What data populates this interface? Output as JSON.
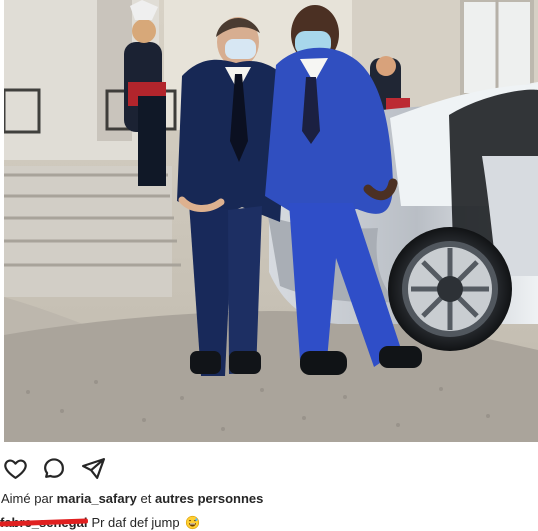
{
  "post": {
    "photo": {
      "description_icon": "photo"
    },
    "actions": [
      {
        "name": "like",
        "icon": "heart-icon"
      },
      {
        "name": "comment",
        "icon": "comment-icon"
      },
      {
        "name": "share",
        "icon": "send-icon"
      }
    ],
    "likes": {
      "prefix": "Aimé par",
      "user": "maria_safary",
      "middle": "et",
      "rest": "autres personnes"
    },
    "caption": {
      "username": "fabre_senegal",
      "text": "Pr daf def jump",
      "emoji": "grinning-face-with-sweat"
    }
  }
}
